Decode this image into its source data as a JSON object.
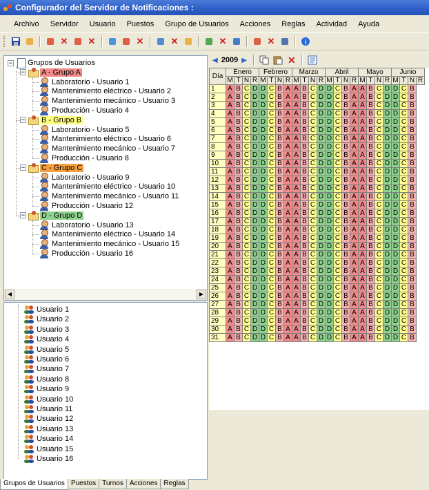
{
  "window": {
    "title": "Configurador del Servidor de Notificaciones :"
  },
  "menu": [
    "Archivo",
    "Servidor",
    "Usuario",
    "Puestos",
    "Grupo de Usuarios",
    "Acciones",
    "Reglas",
    "Actividad",
    "Ayuda"
  ],
  "toolbar": {
    "icons": [
      "save-icon",
      "open-icon",
      "edit-user-icon",
      "delete-user-icon",
      "edit-group-icon",
      "delete-group-icon",
      "add-group-icon",
      "edit-group2-icon",
      "delete-group2-icon",
      "edit-position-icon",
      "delete-position-icon",
      "add-action-icon",
      "edit-action-icon",
      "delete-action-icon",
      "rule-add-icon",
      "rule-edit-icon",
      "rule-delete-icon",
      "report-icon",
      "help-icon"
    ]
  },
  "tree": {
    "root": "Grupos de Usuarios",
    "groups": [
      {
        "label": "A - Grupo A",
        "color": "#f28a8a",
        "users": [
          "Laboratorio - Usuario 1",
          "Mantenimiento eléctrico - Usuario 2",
          "Mantenimiento mecánico - Usuario 3",
          "Producción - Usuario 4"
        ]
      },
      {
        "label": "B - Grupo B",
        "color": "#ffff80",
        "users": [
          "Laboratorio - Usuario 5",
          "Mantenimiento eléctrico - Usuario 6",
          "Mantenimiento mecánico - Usuario 7",
          "Producción - Usuario 8"
        ]
      },
      {
        "label": "C - Grupo C",
        "color": "#f7a040",
        "users": [
          "Laboratorio - Usuario 9",
          "Mantenimiento eléctrico - Usuario 10",
          "Mantenimiento mecánico - Usuario 11",
          "Producción - Usuario 12"
        ]
      },
      {
        "label": "D - Grupo D",
        "color": "#8fd28f",
        "users": [
          "Laboratorio - Usuario 13",
          "Mantenimiento eléctrico - Usuario 14",
          "Mantenimiento mecánico - Usuario 15",
          "Producción - Usuario 16"
        ]
      }
    ]
  },
  "users_list": [
    "Usuario 1",
    "Usuario 2",
    "Usuario 3",
    "Usuario 4",
    "Usuario 5",
    "Usuario 6",
    "Usuario 7",
    "Usuario 8",
    "Usuario 9",
    "Usuario 10",
    "Usuario 11",
    "Usuario 12",
    "Usuario 13",
    "Usuario 14",
    "Usuario 15",
    "Usuario 16"
  ],
  "tabs": [
    "Grupos de Usuarios",
    "Puestos",
    "Turnos",
    "Acciones",
    "Reglas"
  ],
  "active_tab": "Grupos de Usuarios",
  "calendar": {
    "year": "2009",
    "day_header": "Día",
    "months": [
      "Enero",
      "Febrero",
      "Marzo",
      "Abril",
      "Mayo",
      "Junio"
    ],
    "shifts": [
      "M",
      "T",
      "N",
      "R"
    ],
    "days": [
      "1",
      "2",
      "3",
      "4",
      "5",
      "6",
      "7",
      "8",
      "9",
      "10",
      "11",
      "12",
      "13",
      "14",
      "15",
      "16",
      "17",
      "18",
      "19",
      "20",
      "21",
      "22",
      "23",
      "24",
      "25",
      "26",
      "27",
      "28",
      "29",
      "30",
      "31"
    ],
    "row_pattern": [
      "A",
      "B",
      "C",
      "D",
      "D",
      "C",
      "B",
      "A",
      "A",
      "B",
      "C",
      "D",
      "D",
      "C",
      "B",
      "A",
      "A",
      "B",
      "C",
      "D",
      "D",
      "C",
      "B"
    ],
    "colors": {
      "A": "#f28a8a",
      "B": "#f6b0b0",
      "C": "#ffff90",
      "D": "#8fd28f"
    }
  }
}
